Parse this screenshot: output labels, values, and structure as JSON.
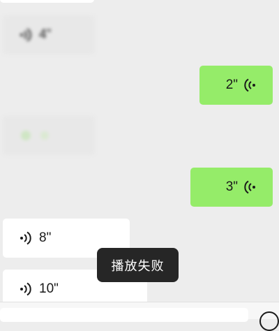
{
  "messages": [
    {
      "direction": "in",
      "blurred": false,
      "duration": ""
    },
    {
      "direction": "in",
      "blurred": true,
      "duration": "4\""
    },
    {
      "direction": "out",
      "blurred": false,
      "duration": "2\""
    },
    {
      "direction": "in",
      "blurred": true,
      "duration": ""
    },
    {
      "direction": "out",
      "blurred": false,
      "duration": "3\""
    },
    {
      "direction": "in",
      "blurred": false,
      "duration": "8\""
    },
    {
      "direction": "in",
      "blurred": false,
      "duration": "10\""
    }
  ],
  "toast": {
    "text": "播放失败"
  },
  "icons": {
    "voice": "voice-wave-icon",
    "emoji": "emoji-icon"
  },
  "colors": {
    "chat_background": "#ededed",
    "incoming_bubble": "#ffffff",
    "outgoing_bubble": "#95ec69",
    "toast_background": "#262626"
  }
}
